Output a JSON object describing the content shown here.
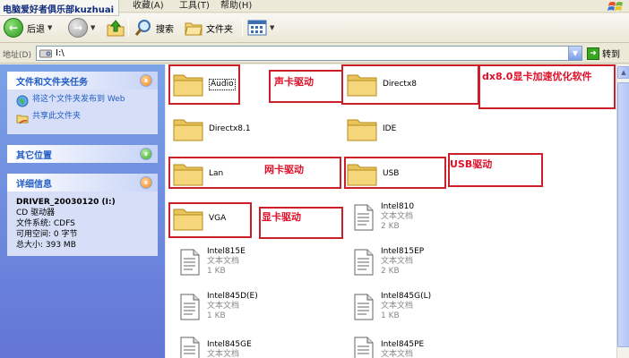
{
  "menubar": {
    "watermark": "电脑爱好者俱乐部kuzhuai",
    "menu_items": [
      "收藏(A)",
      "工具(T)",
      "帮助(H)"
    ]
  },
  "toolbar": {
    "back_label": "后退",
    "search_label": "搜索",
    "folders_label": "文件夹"
  },
  "address": {
    "label": "地址(D)",
    "value": "I:\\",
    "go_label": "转到"
  },
  "task_pane": {
    "file_tasks": {
      "title": "文件和文件夹任务",
      "items": [
        "将这个文件夹发布到 Web",
        "共享此文件夹"
      ]
    },
    "other_places": {
      "title": "其它位置"
    },
    "details": {
      "title": "详细信息",
      "name": "DRIVER_20030120 (I:)",
      "type": "CD 驱动器",
      "filesystem": "文件系统: CDFS",
      "free": "可用空间: 0 字节",
      "total": "总大小: 393 MB"
    }
  },
  "files": {
    "folders": [
      "Audio",
      "Directx8",
      "Directx8.1",
      "IDE",
      "Lan",
      "USB",
      "VGA"
    ],
    "docs": [
      {
        "name": "Intel810",
        "type": "文本文档",
        "size": "2 KB"
      },
      {
        "name": "Intel815E",
        "type": "文本文档",
        "size": "1 KB"
      },
      {
        "name": "Intel815EP",
        "type": "文本文档",
        "size": "2 KB"
      },
      {
        "name": "Intel845D(E)",
        "type": "文本文档",
        "size": "1 KB"
      },
      {
        "name": "Intel845G(L)",
        "type": "文本文档",
        "size": "1 KB"
      },
      {
        "name": "Intel845GE",
        "type": "文本文档",
        "size": ""
      },
      {
        "name": "Intel845PE",
        "type": "文本文档",
        "size": ""
      }
    ]
  },
  "annotations": {
    "sound": "声卡驱动",
    "dx": "dx8.0显卡加速优化软件",
    "lan": "网卡驱动",
    "usb": "USB驱动",
    "vga": "显卡驱动"
  },
  "colors": {
    "annotation_red": "#e0102a",
    "taskpane_blue": "#6375d6",
    "panel_header_text": "#215dc6",
    "folder_yellow": "#f6d67a"
  }
}
